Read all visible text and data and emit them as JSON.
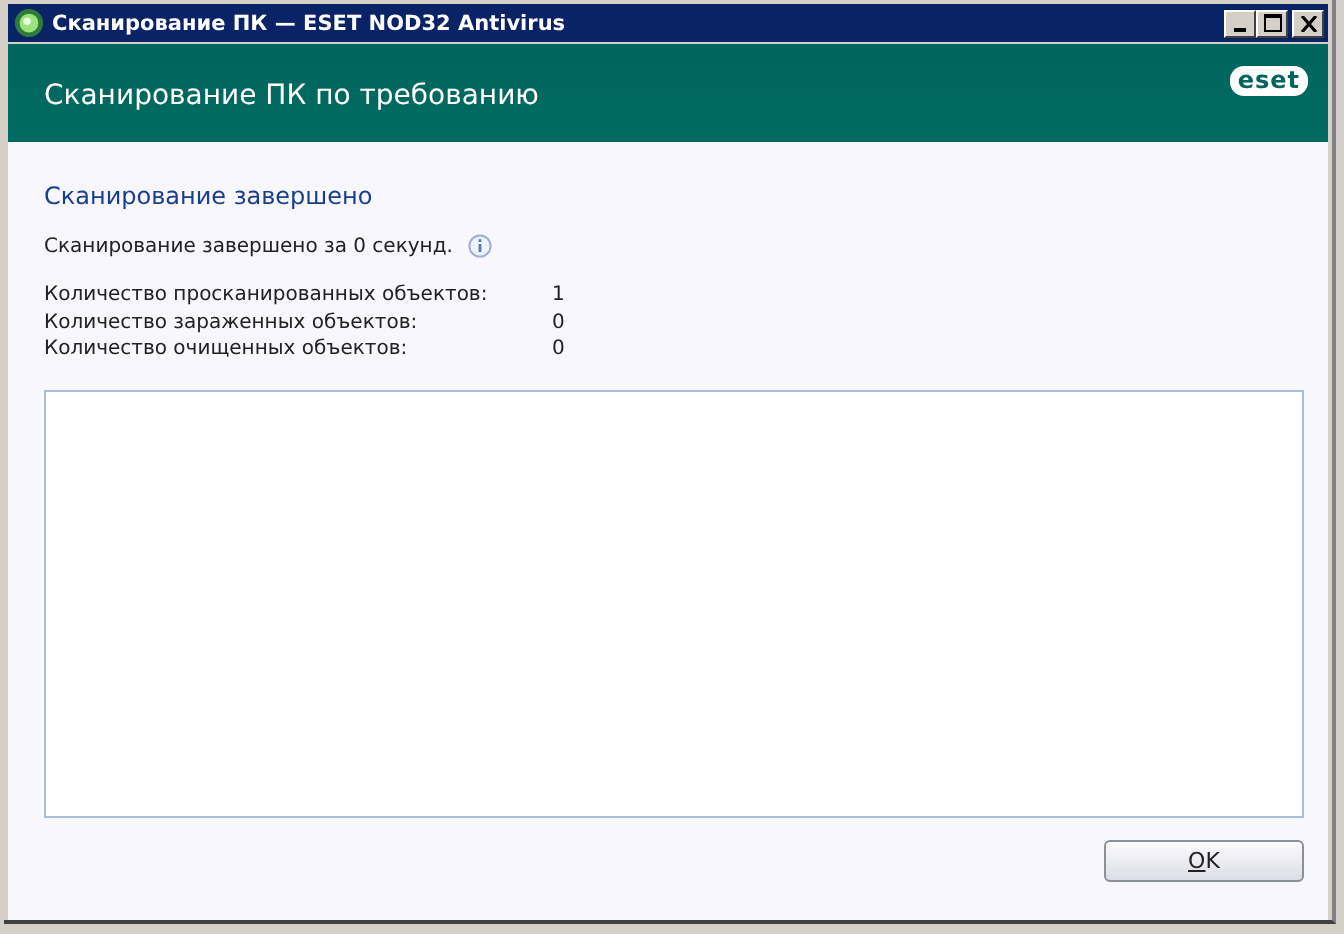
{
  "window": {
    "title": "Сканирование ПК — ESET NOD32 Antivirus"
  },
  "header": {
    "title": "Сканирование ПК по требованию",
    "logo": "eset"
  },
  "heading": "Сканирование завершено",
  "summary": "Сканирование завершено за 0 секунд.",
  "stats": [
    {
      "label": "Количество просканированных объектов:",
      "value": "1"
    },
    {
      "label": "Количество зараженных объектов:",
      "value": "0"
    },
    {
      "label": "Количество очищенных объектов:",
      "value": "0"
    }
  ],
  "buttons": [
    {
      "label": "OK"
    }
  ]
}
